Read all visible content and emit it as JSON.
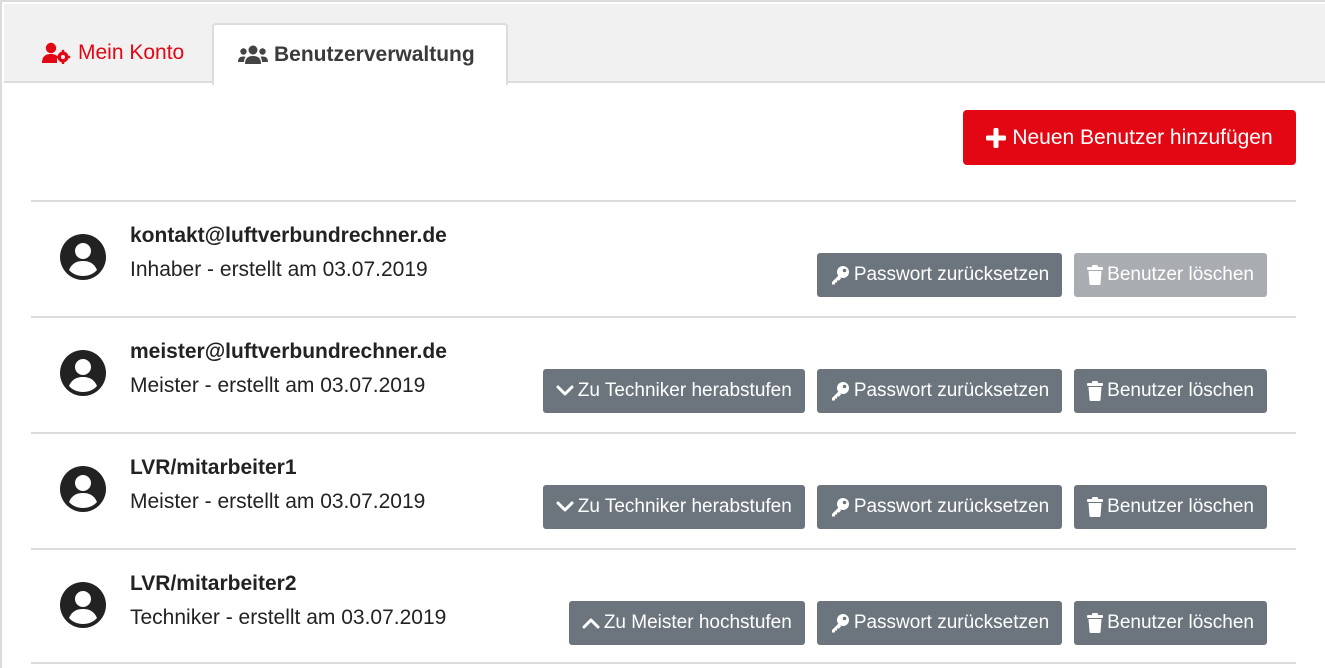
{
  "tabs": [
    {
      "label": "Mein Konto",
      "icon": "user-cog-icon",
      "color": "#e30613"
    },
    {
      "label": "Benutzerverwaltung",
      "icon": "users-icon",
      "active": true
    }
  ],
  "add_button": {
    "label": "Neuen Benutzer hinzufügen",
    "icon": "plus-icon",
    "color": "#e30613"
  },
  "users": [
    {
      "name": "kontakt@luftverbundrechner.de",
      "meta": "Inhaber - erstellt am 03.07.2019",
      "role_action": null,
      "reset_label": "Passwort zurücksetzen",
      "delete_label": "Benutzer löschen",
      "delete_disabled": true
    },
    {
      "name": "meister@luftverbundrechner.de",
      "meta": "Meister - erstellt am 03.07.2019",
      "role_action": {
        "label": "Zu Techniker herabstufen",
        "icon": "chevron-down-icon"
      },
      "reset_label": "Passwort zurücksetzen",
      "delete_label": "Benutzer löschen",
      "delete_disabled": false
    },
    {
      "name": "LVR/mitarbeiter1",
      "meta": "Meister - erstellt am 03.07.2019",
      "role_action": {
        "label": "Zu Techniker herabstufen",
        "icon": "chevron-down-icon"
      },
      "reset_label": "Passwort zurücksetzen",
      "delete_label": "Benutzer löschen",
      "delete_disabled": false
    },
    {
      "name": "LVR/mitarbeiter2",
      "meta": "Techniker - erstellt am 03.07.2019",
      "role_action": {
        "label": "Zu Meister hochstufen",
        "icon": "chevron-up-icon"
      },
      "reset_label": "Passwort zurücksetzen",
      "delete_label": "Benutzer löschen",
      "delete_disabled": false
    }
  ]
}
